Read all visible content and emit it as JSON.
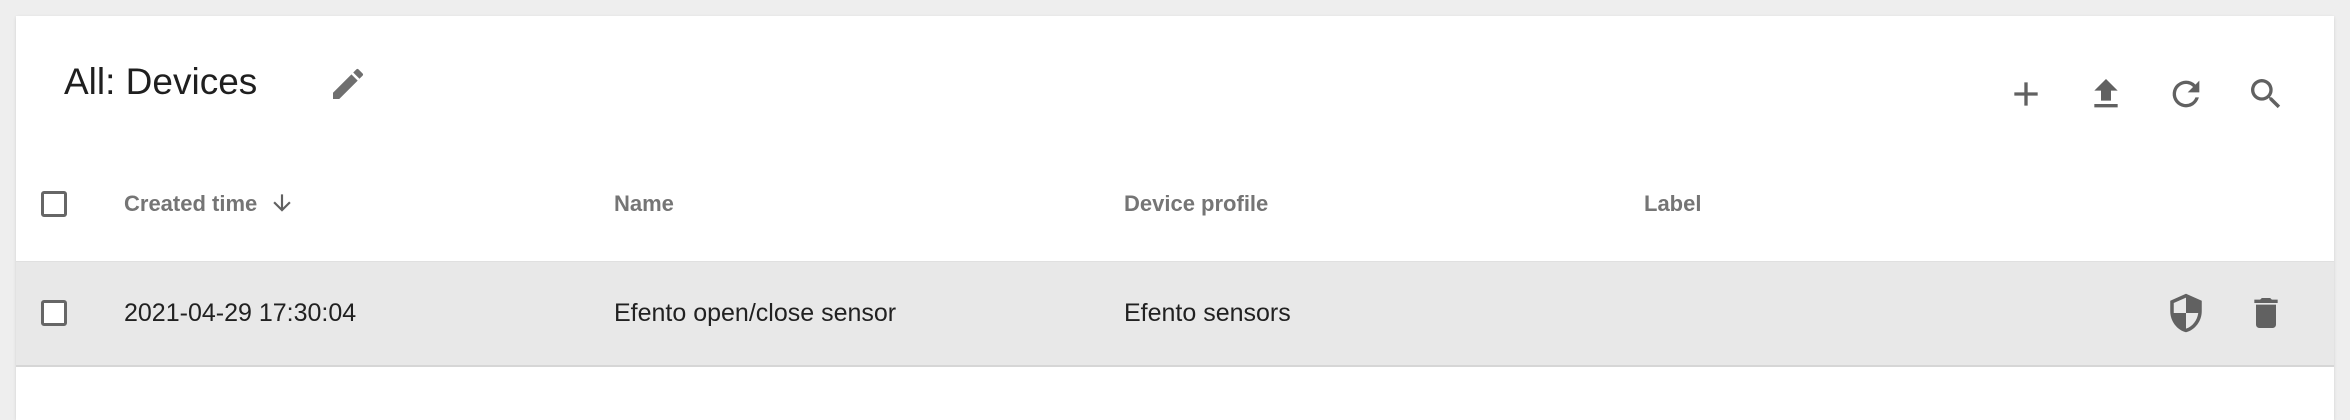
{
  "header": {
    "title": "All: Devices"
  },
  "toolbar": {
    "actions": [
      {
        "icon": "add-icon"
      },
      {
        "icon": "upload-icon"
      },
      {
        "icon": "refresh-icon"
      },
      {
        "icon": "search-icon"
      }
    ]
  },
  "table": {
    "columns": [
      {
        "label": "Created time",
        "sort": "descending"
      },
      {
        "label": "Name"
      },
      {
        "label": "Device profile"
      },
      {
        "label": "Label"
      }
    ],
    "rows": [
      {
        "created_time": "2021-04-29 17:30:04",
        "name": "Efento open/close sensor",
        "device_profile": "Efento sensors",
        "label": "",
        "actions": [
          "shield-icon",
          "delete-icon"
        ]
      }
    ]
  },
  "colors": {
    "background": "#eeeeee",
    "card": "#ffffff",
    "row_hover": "#e8e8e8",
    "icon": "#616161",
    "header_text": "#757575"
  }
}
